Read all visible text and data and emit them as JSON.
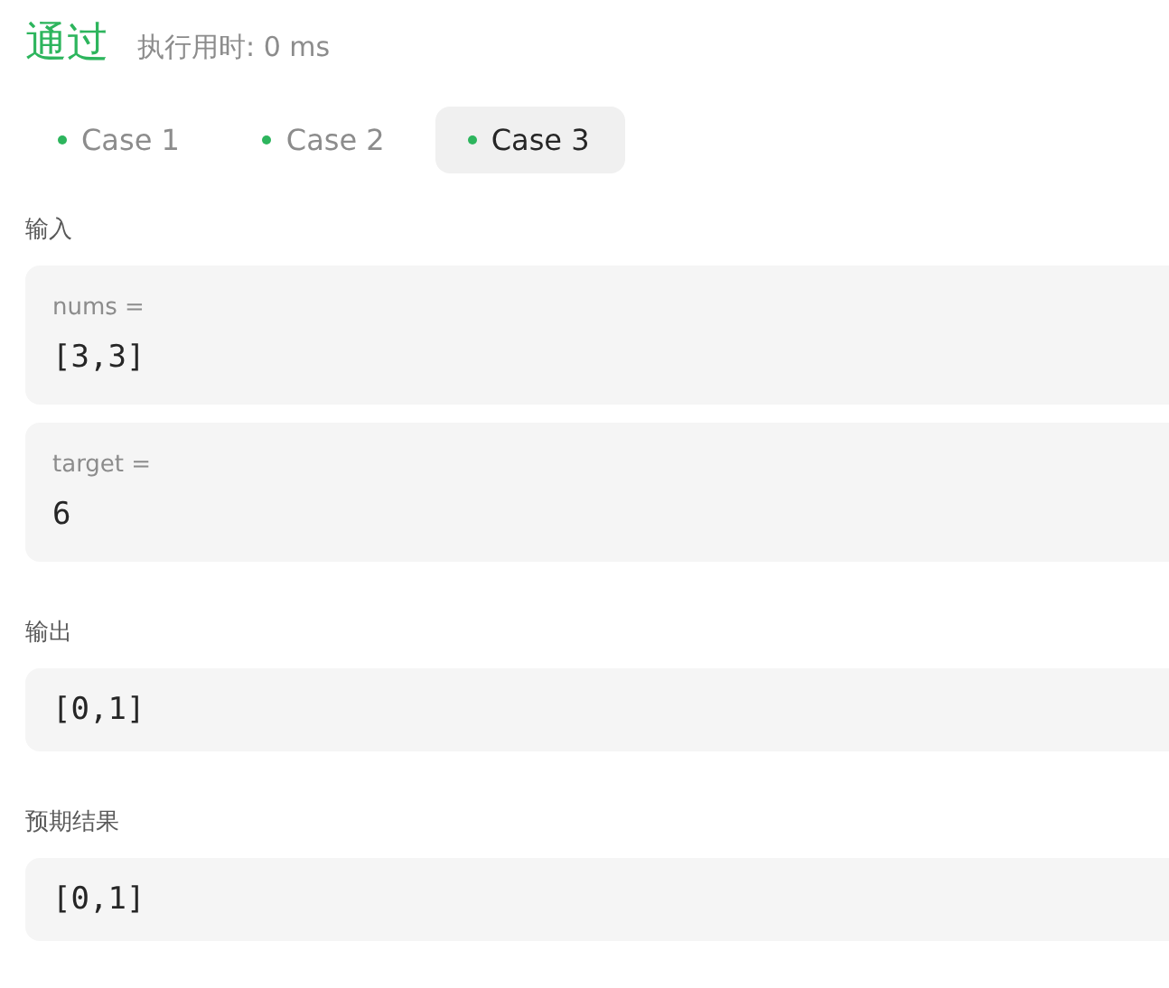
{
  "result": {
    "status": "通过",
    "runtime": "执行用时: 0 ms"
  },
  "tabs": [
    {
      "label": "Case 1",
      "selected": false
    },
    {
      "label": "Case 2",
      "selected": false
    },
    {
      "label": "Case 3",
      "selected": true
    }
  ],
  "sections": [
    {
      "heading": "输入",
      "cards": [
        {
          "name": "nums =",
          "value": "[3,3]"
        },
        {
          "name": "target =",
          "value": "6"
        }
      ]
    },
    {
      "heading": "输出",
      "cards": [
        {
          "value": "[0,1]"
        }
      ]
    },
    {
      "heading": "预期结果",
      "cards": [
        {
          "value": "[0,1]"
        }
      ]
    }
  ]
}
